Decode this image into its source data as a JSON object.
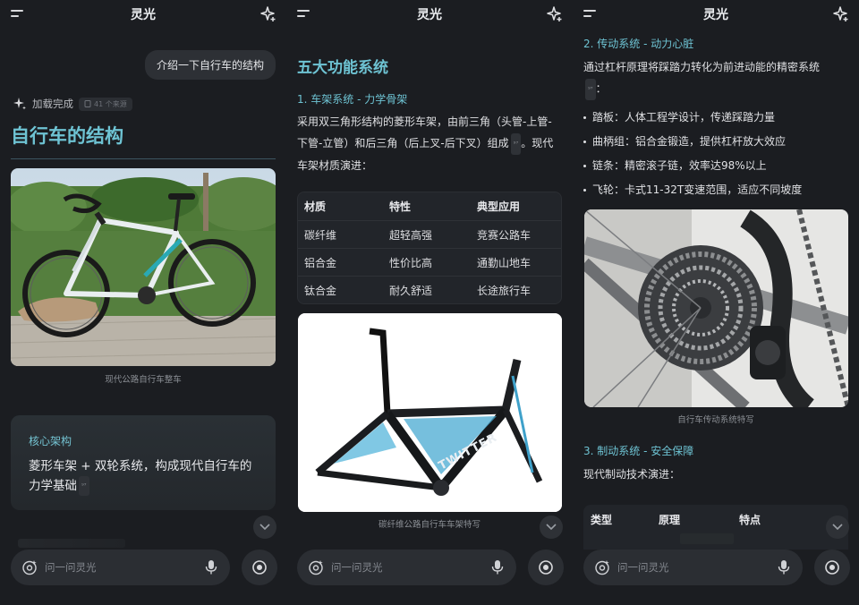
{
  "app_title": "灵光",
  "input_placeholder": "问一问灵光",
  "panel1": {
    "user_message": "介绍一下自行车的结构",
    "status_label": "加载完成",
    "source_badge": "41 个来源",
    "title": "自行车的结构",
    "image_caption": "现代公路自行车整车",
    "core_card": {
      "title": "核心架构",
      "body": "菱形车架 + 双轮系统，构成现代自行车的力学基础"
    }
  },
  "panel2": {
    "section_title": "五大功能系统",
    "subsection_title": "1. 车架系统 - 力学骨架",
    "paragraph": "采用双三角形结构的菱形车架，由前三角（头管-上管-下管-立管）和后三角（后上叉-后下叉）组成",
    "paragraph_tail": "。现代车架材质演进：",
    "table_headers": [
      "材质",
      "特性",
      "典型应用"
    ],
    "table_rows": [
      [
        "碳纤维",
        "超轻高强",
        "竞赛公路车"
      ],
      [
        "铝合金",
        "性价比高",
        "通勤山地车"
      ],
      [
        "钛合金",
        "耐久舒适",
        "长途旅行车"
      ]
    ],
    "image_caption": "碳纤维公路自行车车架特写",
    "frame_brand": "TWITTER"
  },
  "panel3": {
    "subsection_title": "2. 传动系统 - 动力心脏",
    "paragraph": "通过杠杆原理将踩踏力转化为前进动能的精密系统",
    "bullets": [
      "踏板：人体工程学设计，传递踩踏力量",
      "曲柄组：铝合金锻造，提供杠杆放大效应",
      "链条：精密滚子链，效率达98%以上",
      "飞轮：卡式11-32T变速范围，适应不同坡度"
    ],
    "image_caption": "自行车传动系统特写",
    "brake_title": "3. 制动系统 - 安全保障",
    "brake_intro": "现代制动技术演进：",
    "brake_table_headers": [
      "类型",
      "原理",
      "特点"
    ]
  },
  "colors": {
    "accent": "#6ec3d3",
    "panel_bg": "#1b1d21",
    "surface": "#2b2e33"
  },
  "icons": [
    "menu-icon",
    "new-chat-icon",
    "sparkle-icon",
    "camera-sparkle-icon",
    "mic-icon",
    "voice-call-icon",
    "chevron-down-icon"
  ]
}
